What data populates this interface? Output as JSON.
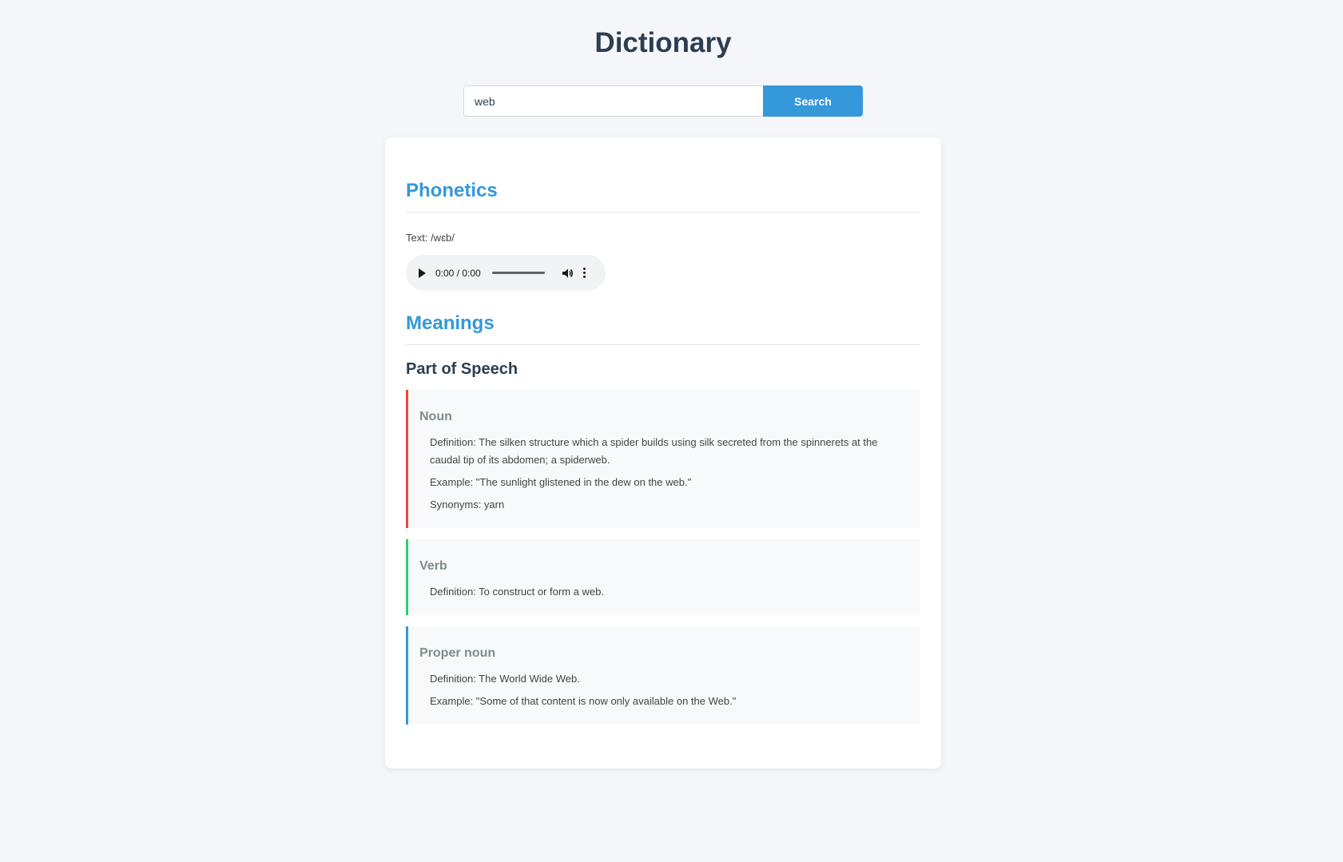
{
  "app": {
    "title": "Dictionary"
  },
  "search": {
    "value": "web",
    "button_label": "Search"
  },
  "phonetics": {
    "heading": "Phonetics",
    "text_line": "Text: /wɛb/",
    "audio": {
      "time": "0:00 / 0:00",
      "progress": 0
    }
  },
  "meanings": {
    "heading": "Meanings",
    "subheading": "Part of Speech",
    "items": [
      {
        "part": "Noun",
        "accent": "#e74c3c",
        "lines": [
          "Definition: The silken structure which a spider builds using silk secreted from the spinnerets at the caudal tip of its abdomen; a spiderweb.",
          "Example: \"The sunlight glistened in the dew on the web.\"",
          "Synonyms: yarn"
        ]
      },
      {
        "part": "Verb",
        "accent": "#2ecc71",
        "lines": [
          "Definition: To construct or form a web."
        ]
      },
      {
        "part": "Proper noun",
        "accent": "#3498db",
        "lines": [
          "Definition: The World Wide Web.",
          "Example: \"Some of that content is now only available on the Web.\""
        ]
      }
    ]
  }
}
